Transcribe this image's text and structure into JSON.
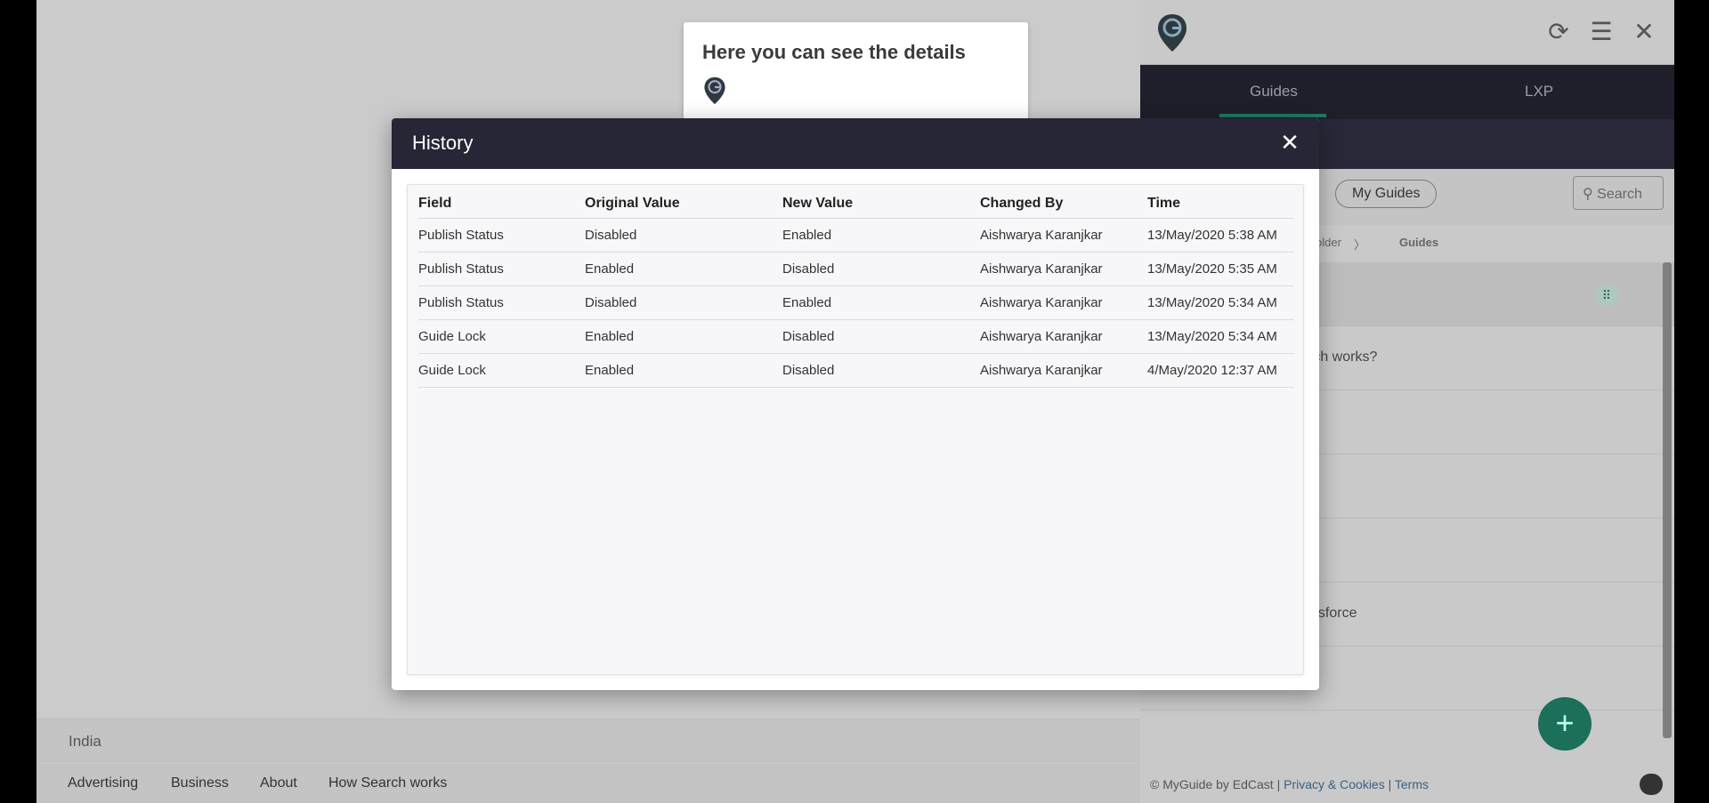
{
  "page": {
    "country": "India",
    "footer_links": [
      "Advertising",
      "Business",
      "About",
      "How Search works"
    ]
  },
  "panel": {
    "tabs": [
      "Guides",
      "LXP"
    ],
    "my_guides": "My Guides",
    "search": "Search",
    "breadcrumb_folder": "older",
    "breadcrumb_sep": "〉",
    "breadcrumb_current": "Guides",
    "row_text_1": "rch works?",
    "row_text_2": "esforce",
    "footer_copyright": "© MyGuide by EdCast",
    "footer_sep": "|",
    "footer_privacy": "Privacy & Cookies",
    "footer_terms": "Terms",
    "icons": [
      "refresh-icon",
      "menu-icon",
      "close-icon"
    ]
  },
  "tooltip": {
    "title": "Here you can see the details"
  },
  "modal": {
    "title": "History",
    "close": "✕",
    "columns": [
      "Field",
      "Original Value",
      "New Value",
      "Changed By",
      "Time"
    ],
    "rows": [
      [
        "Publish Status",
        "Disabled",
        "Enabled",
        "Aishwarya Karanjkar",
        "13/May/2020 5:38 AM"
      ],
      [
        "Publish Status",
        "Enabled",
        "Disabled",
        "Aishwarya Karanjkar",
        "13/May/2020 5:35 AM"
      ],
      [
        "Publish Status",
        "Disabled",
        "Enabled",
        "Aishwarya Karanjkar",
        "13/May/2020 5:34 AM"
      ],
      [
        "Guide Lock",
        "Enabled",
        "Disabled",
        "Aishwarya Karanjkar",
        "13/May/2020 5:34 AM"
      ],
      [
        "Guide Lock",
        "Enabled",
        "Disabled",
        "Aishwarya Karanjkar",
        "4/May/2020 12:37 AM"
      ]
    ]
  },
  "colors": {
    "modal_header": "#262637",
    "accent_green": "#1c6f59"
  }
}
